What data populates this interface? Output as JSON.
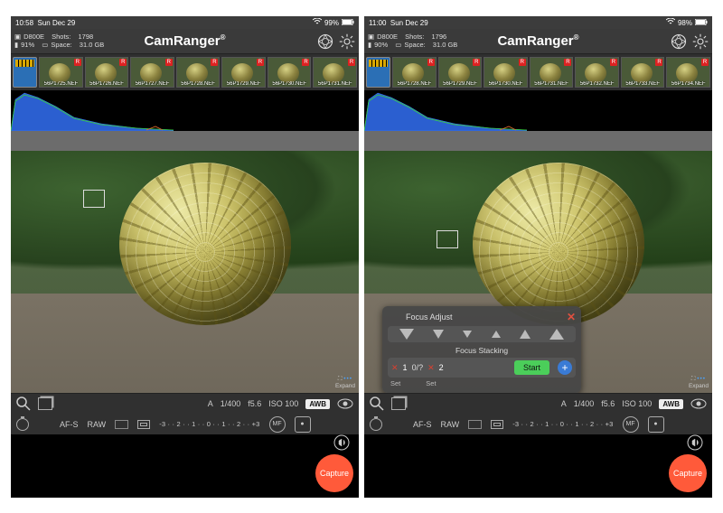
{
  "app": {
    "brand": "CamRanger"
  },
  "screens": [
    {
      "status": {
        "time": "10:58",
        "date": "Sun Dec 29",
        "wifi_pct": "99%"
      },
      "info": {
        "camera": "D800E",
        "shots_label": "Shots:",
        "shots": "1798",
        "battery_pct": "91%",
        "space_label": "Space:",
        "space": "31.0 GB"
      },
      "thumbnails": [
        {
          "file": "56P1725.NEF",
          "tag": "R"
        },
        {
          "file": "56P1726.NEF",
          "tag": "R"
        },
        {
          "file": "56P1727.NEF",
          "tag": "R"
        },
        {
          "file": "56P1728.NEF",
          "tag": "R"
        },
        {
          "file": "56P1729.NEF",
          "tag": "R"
        },
        {
          "file": "56P1730.NEF",
          "tag": "R"
        },
        {
          "file": "56P1731.NEF",
          "tag": "R"
        }
      ],
      "settings_row1": {
        "mode": "A",
        "shutter": "1/400",
        "aperture": "f5.6",
        "iso": "ISO 100",
        "wb": "AWB"
      },
      "settings_row2": {
        "af": "AF-S",
        "format": "RAW",
        "ev_scale": "-3 · · 2 · · 1 · · 0 · · 1 · · 2 · · +3",
        "mf": "MF"
      },
      "expand": "Expand",
      "capture": "Capture",
      "focus_panel": null
    },
    {
      "status": {
        "time": "11:00",
        "date": "Sun Dec 29",
        "wifi_pct": "98%"
      },
      "info": {
        "camera": "D800E",
        "shots_label": "Shots:",
        "shots": "1796",
        "battery_pct": "90%",
        "space_label": "Space:",
        "space": "31.0 GB"
      },
      "thumbnails": [
        {
          "file": "56P1728.NEF",
          "tag": "R"
        },
        {
          "file": "56P1729.NEF",
          "tag": "R"
        },
        {
          "file": "56P1730.NEF",
          "tag": "R"
        },
        {
          "file": "56P1731.NEF",
          "tag": "R"
        },
        {
          "file": "56P1732.NEF",
          "tag": "R"
        },
        {
          "file": "56P1733.NEF",
          "tag": "R"
        },
        {
          "file": "56P1734.NEF",
          "tag": "R"
        }
      ],
      "settings_row1": {
        "mode": "A",
        "shutter": "1/400",
        "aperture": "f5.6",
        "iso": "ISO 100",
        "wb": "AWB"
      },
      "settings_row2": {
        "af": "AF-S",
        "format": "RAW",
        "ev_scale": "-3 · · 2 · · 1 · · 0 · · 1 · · 2 · · +3",
        "mf": "MF"
      },
      "expand": "Expand",
      "capture": "Capture",
      "focus_panel": {
        "adjust_title": "Focus Adjust",
        "stack_title": "Focus Stacking",
        "point_a": "1",
        "counter": "0/?",
        "point_b": "2",
        "start": "Start",
        "set": "Set"
      }
    }
  ]
}
